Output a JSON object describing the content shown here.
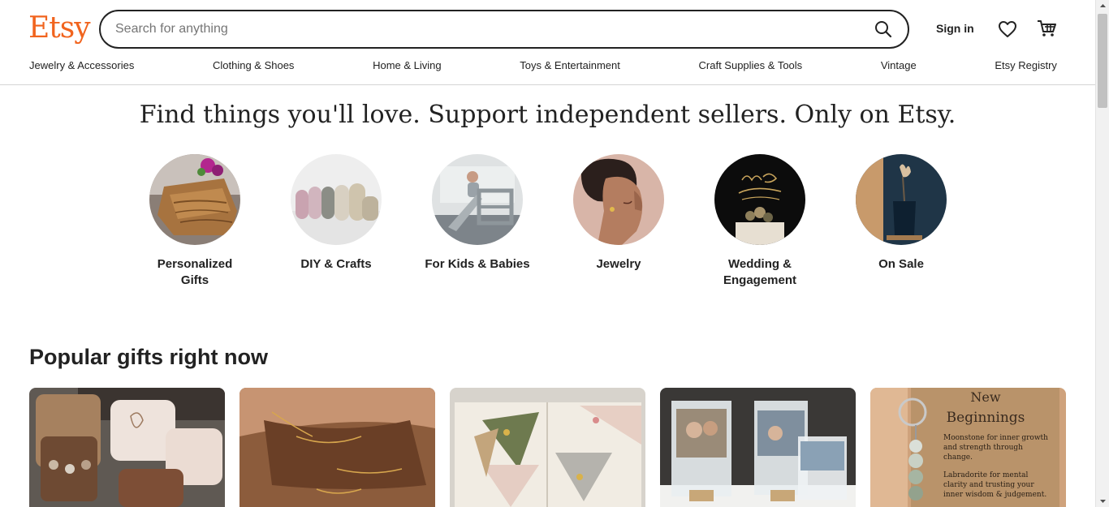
{
  "header": {
    "logo": "Etsy",
    "search_placeholder": "Search for anything",
    "signin_label": "Sign in",
    "accent_color": "#f1641e"
  },
  "nav": {
    "items": [
      "Jewelry & Accessories",
      "Clothing & Shoes",
      "Home & Living",
      "Toys & Entertainment",
      "Craft Supplies & Tools",
      "Vintage",
      "Etsy Registry"
    ]
  },
  "hero": {
    "headline": "Find things you'll love. Support independent sellers. Only on Etsy."
  },
  "categories": [
    {
      "label": "Personalized Gifts"
    },
    {
      "label": "DIY & Crafts"
    },
    {
      "label": "For Kids & Babies"
    },
    {
      "label": "Jewelry"
    },
    {
      "label": "Wedding & Engagement"
    },
    {
      "label": "On Sale"
    }
  ],
  "popular": {
    "title": "Popular gifts right now",
    "cards": [
      {
        "image": "jewelry-boxes"
      },
      {
        "image": "name-necklaces"
      },
      {
        "image": "embroidered-bookmarks"
      },
      {
        "image": "photo-plaques"
      },
      {
        "image": "moonstone-keychain",
        "text_heading_1": "New",
        "text_heading_2": "Beginnings",
        "line1": "Moonstone for inner growth",
        "line2": "and strength through",
        "line3": "change.",
        "line4": "Labradorite for mental",
        "line5": "clarity and trusting your",
        "line6": "inner wisdom & judgement."
      }
    ]
  }
}
